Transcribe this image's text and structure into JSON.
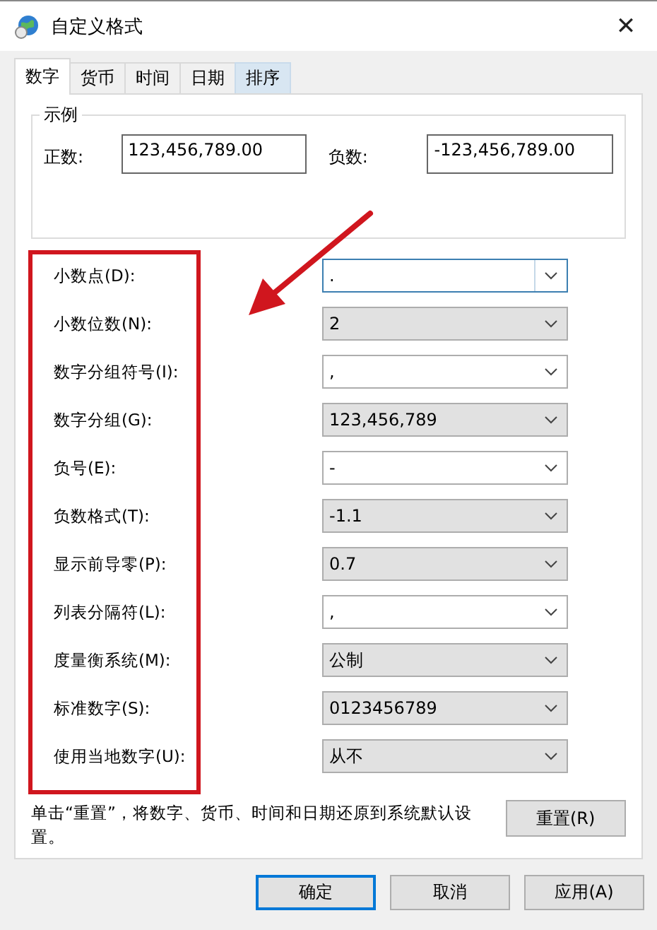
{
  "window": {
    "title": "自定义格式",
    "close": "✕"
  },
  "tabs": [
    {
      "label": "数字",
      "selected": true
    },
    {
      "label": "货币",
      "selected": false
    },
    {
      "label": "时间",
      "selected": false
    },
    {
      "label": "日期",
      "selected": false
    },
    {
      "label": "排序",
      "selected": false,
      "hover": true
    }
  ],
  "example": {
    "title": "示例",
    "positive_label": "正数:",
    "positive_value": "123,456,789.00",
    "negative_label": "负数:",
    "negative_value": "-123,456,789.00"
  },
  "settings": [
    {
      "label": "小数点(D):",
      "value": ".",
      "kind": "combo",
      "focused": true
    },
    {
      "label": "小数位数(N):",
      "value": "2",
      "kind": "list",
      "focused": false
    },
    {
      "label": "数字分组符号(I):",
      "value": ",",
      "kind": "combo",
      "focused": false
    },
    {
      "label": "数字分组(G):",
      "value": "123,456,789",
      "kind": "list",
      "focused": false
    },
    {
      "label": "负号(E):",
      "value": "-",
      "kind": "combo",
      "focused": false
    },
    {
      "label": "负数格式(T):",
      "value": "-1.1",
      "kind": "list",
      "focused": false
    },
    {
      "label": "显示前导零(P):",
      "value": "0.7",
      "kind": "list",
      "focused": false
    },
    {
      "label": "列表分隔符(L):",
      "value": ",",
      "kind": "combo",
      "focused": false
    },
    {
      "label": "度量衡系统(M):",
      "value": "公制",
      "kind": "list",
      "focused": false
    },
    {
      "label": "标准数字(S):",
      "value": "0123456789",
      "kind": "list",
      "focused": false
    },
    {
      "label": "使用当地数字(U):",
      "value": "从不",
      "kind": "list",
      "focused": false
    }
  ],
  "reset": {
    "note": "单击“重置”，将数字、货币、时间和日期还原到系统默认设置。",
    "button": "重置(R)"
  },
  "buttons": [
    {
      "label": "确定",
      "default": true
    },
    {
      "label": "取消",
      "default": false
    },
    {
      "label": "应用(A)",
      "default": false
    }
  ]
}
